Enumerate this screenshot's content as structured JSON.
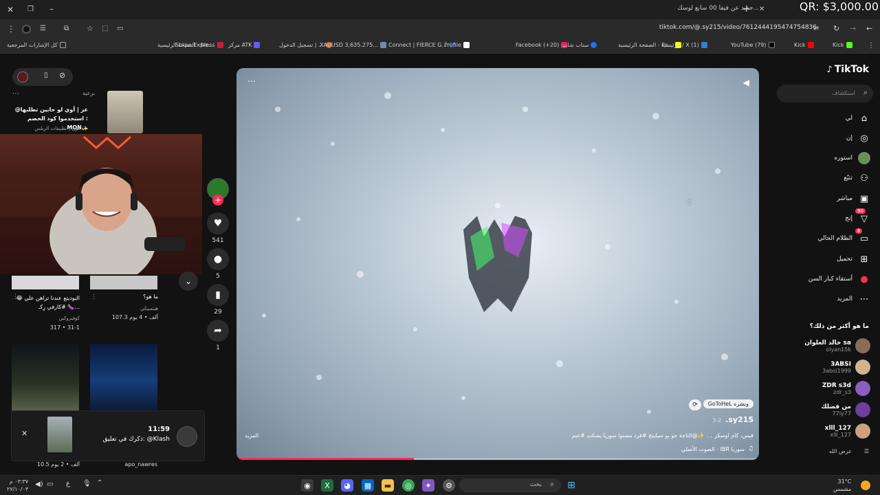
{
  "browser": {
    "tab_title": "جديد عن فيفا 00 سانع لوسك...",
    "qr_overlay": "QR: $3,000.00",
    "url": "tiktok.com/@.sy215/video/7612444195474754836"
  },
  "bookmarks": {
    "all_bookmarks": "كل الإشارات المرجعية",
    "items": [
      "Kick",
      "YouTube (79)",
      "الرئيسية / X (1)",
      "الصفحة الرئيسية - Pa...",
      "سناب شات",
      "Facebook (+20)",
      "Profile",
      "Connect | FIERCE G...",
      "XAUUSD 3,635.275...",
      "تسجيل الدخول | ...",
      "مركز ATK",
      "Stripe Express",
      "الصفحة الرئيسية - Ne..."
    ]
  },
  "tiktok": {
    "logo": "TikTok",
    "search_placeholder": "استكشاف",
    "nav": [
      {
        "label": "لي",
        "icon": "home-icon"
      },
      {
        "label": "إن",
        "icon": "compass-icon"
      },
      {
        "label": "استوره",
        "icon": "profile-icon"
      },
      {
        "label": "تتبّع",
        "icon": "following-icon"
      },
      {
        "label": "مباشر",
        "icon": "live-icon"
      },
      {
        "label": "إنج",
        "icon": "messages-icon",
        "badge": "90"
      },
      {
        "label": "الظلام الخالي",
        "icon": "inbox-icon",
        "badge": "6"
      },
      {
        "label": "تحميل",
        "icon": "upload-icon"
      },
      {
        "label": "أستقاء كبار السن",
        "icon": "creator-icon"
      },
      {
        "label": "المزيد",
        "icon": "more-icon"
      }
    ],
    "suggested_title": "ما هو أكثر من ذلك؟",
    "suggested": [
      {
        "name": "خالد العلوان sa",
        "handle": "olyan15k",
        "color": "#8a6d57"
      },
      {
        "name": "3ABSI",
        "handle": "3absi1999",
        "color": "#d2b48c"
      },
      {
        "name": "ZDR s3d",
        "handle": "zdr_s3",
        "color": "#8b5fbf"
      },
      {
        "name": "من فضلك",
        "handle": "77ly77",
        "color": "#6a3fa0"
      },
      {
        "name": "xlll_127",
        "handle": "xlll_127",
        "color": "#c9a27e"
      }
    ],
    "show_all": "عرض الله"
  },
  "video": {
    "author": ".sy215",
    "date": "3-2",
    "effect_label": "GoToHeL ونشره",
    "caption": "فيس، كام اوسكر ۔۔ ✨@الناجة جو يو سيليتج #فرد مستوا سوريا يسكت #عيم",
    "sound": "الصوت الأصلي - IBR سوريا",
    "more": "المزيد",
    "progress_pct": 0.34
  },
  "actions": {
    "likes": "541",
    "comments": "5",
    "saves": "29",
    "shares": "1"
  },
  "left_panel": {
    "top_card_tag": "برعية",
    "top_card_line1": "@عز | أوي لو حابين تطلبها",
    "top_card_line2": "استخدموا كود الخصم : MON...",
    "top_card_footer": "مون | تطبيقات الريلس ✨",
    "card_a_title": "ما هو؟",
    "card_a_user": "هيثمبيكي",
    "card_a_meta": "107.3 ألف • 4 يوم",
    "card_b_title": "البوديتع عندنا تراهن علي 😂🍆 #كارفي رِكـ...",
    "card_b_user": "كوفيروكين",
    "card_b_meta": "317 • 31-1",
    "bottom_meta": "10.5 ألف • 2 يوم",
    "bottom_user": "apo_nawres"
  },
  "notification": {
    "time": "11:59",
    "text": "ذكرك في تعليق: @Klash"
  },
  "taskbar": {
    "search": "بحث",
    "weather_temp": "31°C",
    "weather_desc": "مشمس",
    "time": "٠٣:٣٧ م",
    "date": "٢٧/١٠/٠٣",
    "lang": "ع"
  }
}
